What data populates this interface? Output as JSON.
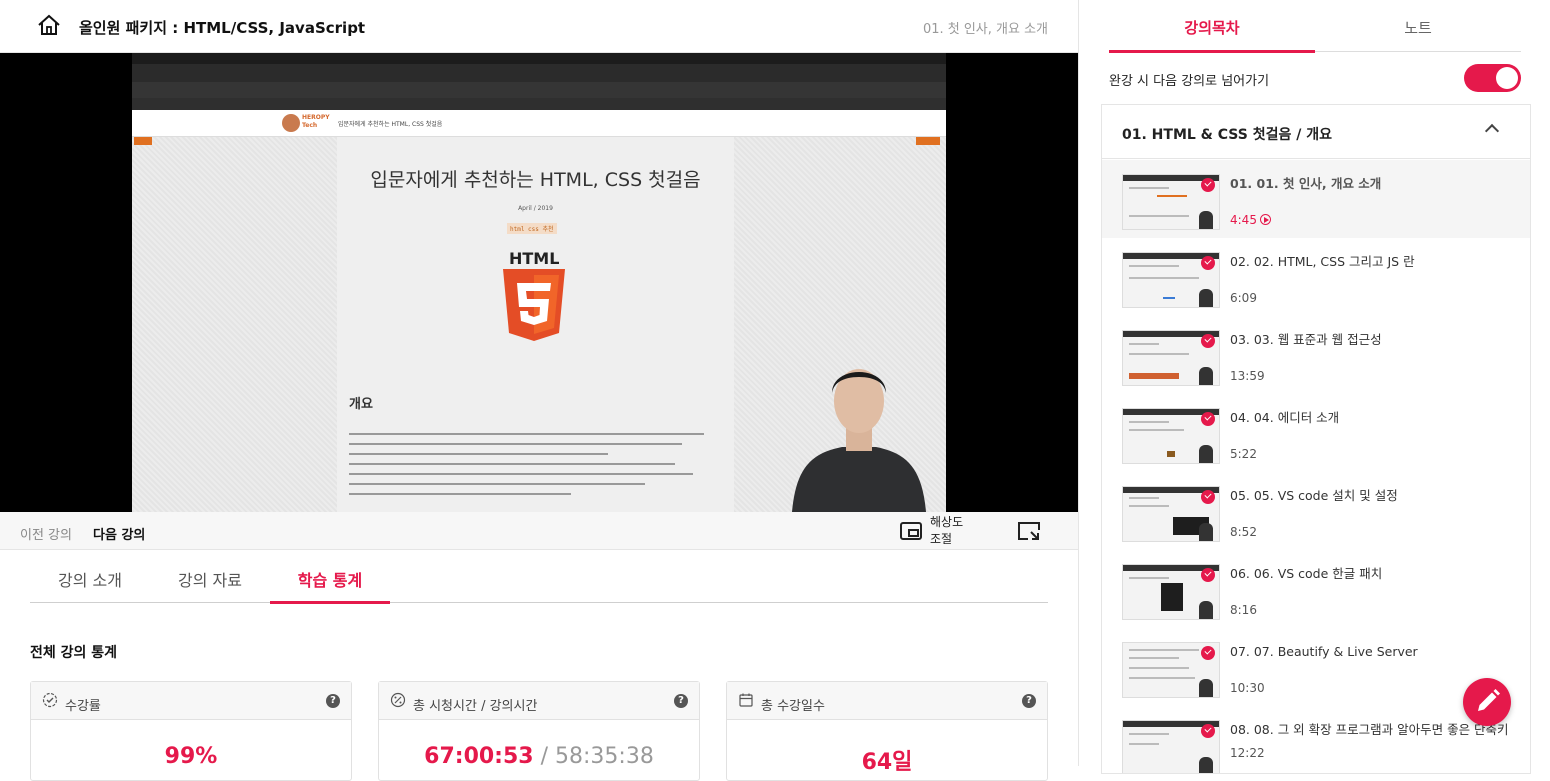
{
  "header": {
    "course_title": "올인원 패키지 : HTML/CSS, JavaScript",
    "current_lecture": "01. 첫 인사, 개요 소개"
  },
  "video": {
    "post_title": "입문자에게 추천하는 HTML, CSS 첫걸음",
    "post_date": "April / 2019",
    "post_tags": "html css 추천",
    "html5_word": "HTML",
    "section_heading": "개요",
    "site_nav": "입문자에게 추천하는 HTML, CSS 첫걸음",
    "site_logo_text": "HEROPY Tech"
  },
  "controls": {
    "prev_label": "이전 강의",
    "next_label": "다음 강의",
    "resolution_label": "해상도 조절"
  },
  "info_tabs": [
    "강의 소개",
    "강의 자료",
    "학습 통계"
  ],
  "stats": {
    "heading": "전체 강의 통계",
    "cards": [
      {
        "title": "수강률",
        "value": "99%"
      },
      {
        "title": "총 시청시간 / 강의시간",
        "value": "67:00:53",
        "sep": " / ",
        "total": "58:35:38"
      },
      {
        "title": "총 수강일수",
        "value": "64일"
      }
    ],
    "help": "?"
  },
  "right": {
    "tabs": [
      "강의목차",
      "노트"
    ],
    "autoplay_label": "완강 시 다음 강의로 넘어가기",
    "autoplay_on": true,
    "section_title": "01. HTML & CSS 첫걸음 / 개요",
    "lectures": [
      {
        "title": "01. 01. 첫 인사, 개요 소개",
        "time": "4:45",
        "current": true
      },
      {
        "title": "02. 02. HTML, CSS 그리고 JS 란",
        "time": "6:09"
      },
      {
        "title": "03. 03. 웹 표준과 웹 접근성",
        "time": "13:59"
      },
      {
        "title": "04. 04. 에디터 소개",
        "time": "5:22"
      },
      {
        "title": "05. 05. VS code 설치 및 설정",
        "time": "8:52"
      },
      {
        "title": "06. 06. VS code 한글 패치",
        "time": "8:16"
      },
      {
        "title": "07. 07. Beautify & Live Server",
        "time": "10:30"
      },
      {
        "title": "08. 08. 그 외 확장 프로그램과 알아두면 좋은 단축키",
        "time": "12:22"
      }
    ]
  },
  "colors": {
    "accent": "#e5194b"
  }
}
